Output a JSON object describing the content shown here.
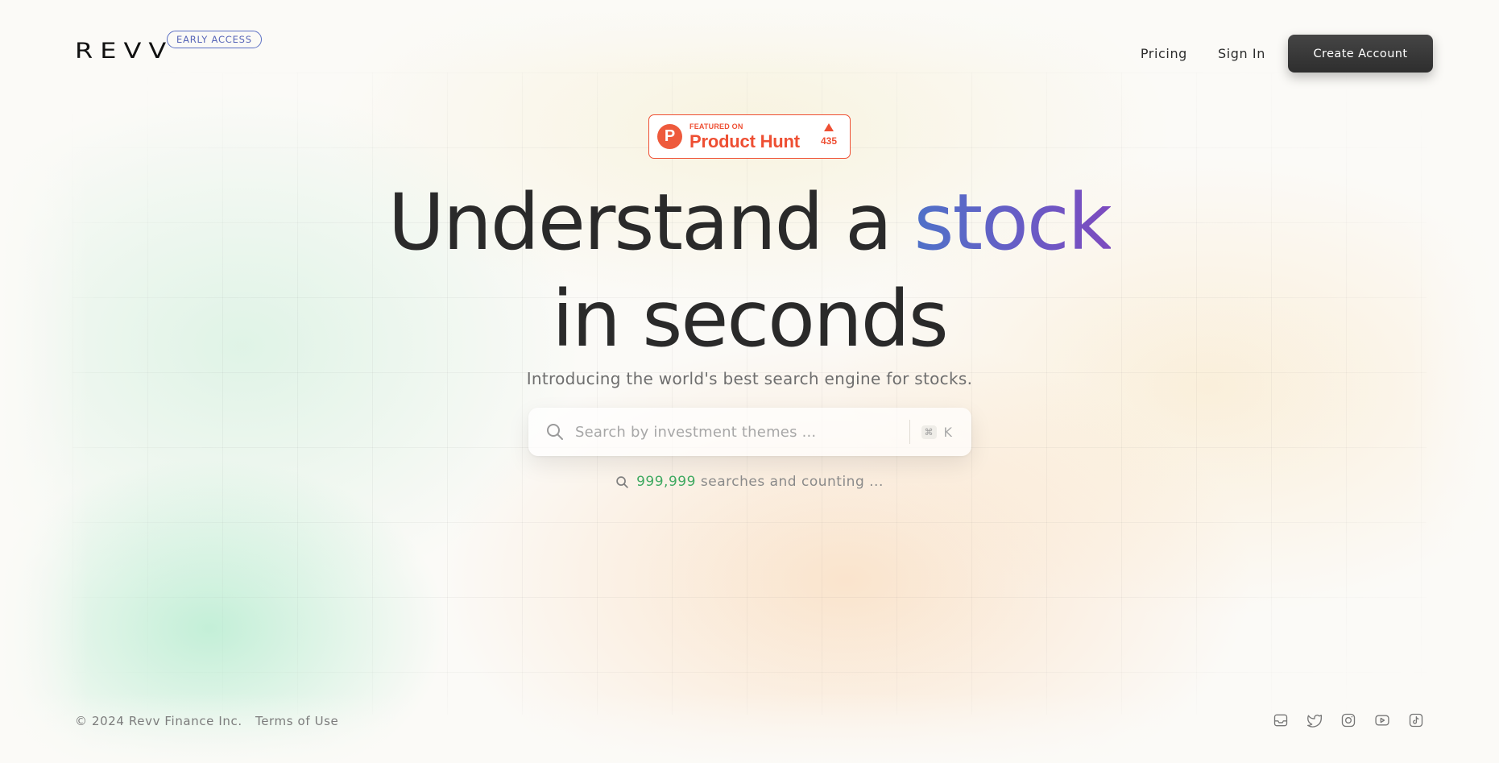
{
  "brand": {
    "name": "REVV",
    "badge": "EARLY ACCESS"
  },
  "nav": {
    "pricing": "Pricing",
    "sign_in": "Sign In",
    "create_account": "Create Account"
  },
  "product_hunt": {
    "featured": "FEATURED ON",
    "name": "Product Hunt",
    "logo_letter": "P",
    "votes": "435"
  },
  "hero": {
    "line1_prefix": "Understand a",
    "line1_accent": "stock",
    "line2": "in seconds",
    "subtitle": "Introducing the world's best search engine for stocks."
  },
  "search": {
    "placeholder": "Search by investment themes ...",
    "shortcut_modifier": "⌘",
    "shortcut_key": "K"
  },
  "counter": {
    "count": "999,999",
    "suffix": "searches and counting ..."
  },
  "footer": {
    "copyright": "© 2024 Revv Finance Inc.",
    "terms": "Terms of Use",
    "social_icons": [
      "mail-icon",
      "twitter-icon",
      "instagram-icon",
      "youtube-icon",
      "tiktok-icon"
    ]
  },
  "colors": {
    "accent_blue": "#4f72c8",
    "accent_purple": "#7d4bbf",
    "product_hunt": "#ee4f33",
    "counter_green": "#3fa961",
    "button_dark": "#3a3a3a"
  }
}
